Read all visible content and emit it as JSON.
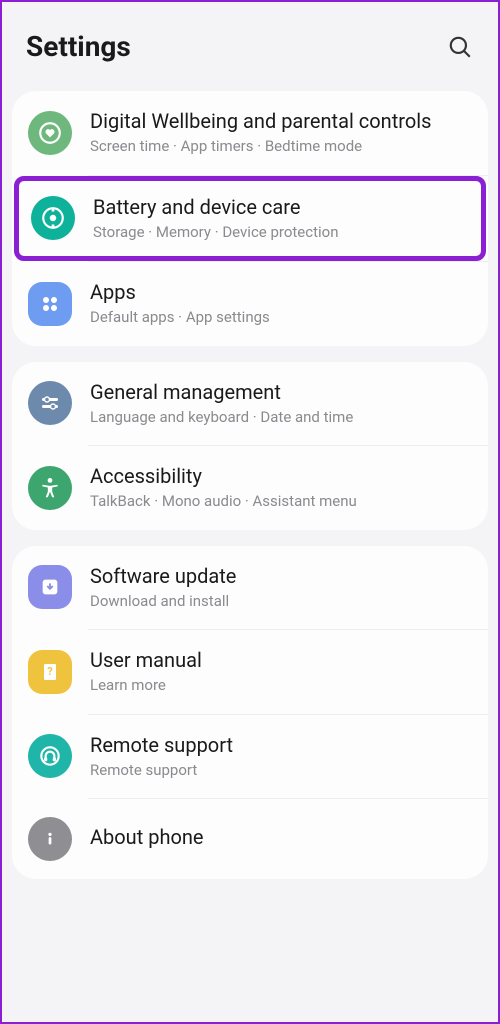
{
  "header": {
    "title": "Settings"
  },
  "sections": [
    {
      "items": [
        {
          "title": "Digital Wellbeing and parental controls",
          "subtitle": "Screen time  ·  App timers  ·  Bedtime mode"
        },
        {
          "title": "Battery and device care",
          "subtitle": "Storage  ·  Memory  ·  Device protection"
        },
        {
          "title": "Apps",
          "subtitle": "Default apps  ·  App settings"
        }
      ]
    },
    {
      "items": [
        {
          "title": "General management",
          "subtitle": "Language and keyboard  ·  Date and time"
        },
        {
          "title": "Accessibility",
          "subtitle": "TalkBack  ·  Mono audio  ·  Assistant menu"
        }
      ]
    },
    {
      "items": [
        {
          "title": "Software update",
          "subtitle": "Download and install"
        },
        {
          "title": "User manual",
          "subtitle": "Learn more"
        },
        {
          "title": "Remote support",
          "subtitle": "Remote support"
        },
        {
          "title": "About phone",
          "subtitle": ""
        }
      ]
    }
  ]
}
